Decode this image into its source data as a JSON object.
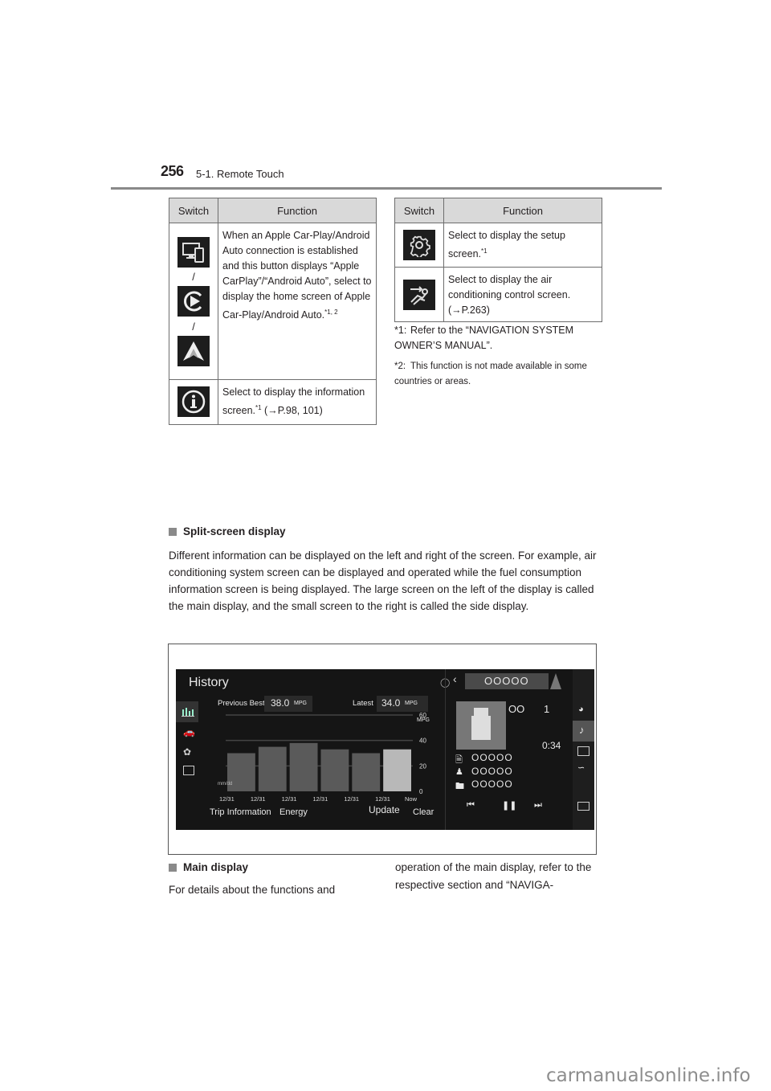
{
  "header": {
    "page_number": "256",
    "section": "5-1. Remote Touch"
  },
  "table_left": {
    "columns": [
      "Switch",
      "Function"
    ],
    "rows": [
      {
        "icons": [
          "apple-carplay-android-auto-icon",
          "carplay-play-icon",
          "android-auto-icon"
        ],
        "separator": "/",
        "function": "When an Apple Car-Play/Android Auto connection is established and this button displays “Apple CarPlay”/“Android Auto”, select to display the home screen of Apple Car-Play/Android Auto.",
        "footnote_ref": "*1, 2"
      },
      {
        "icons": [
          "info-icon"
        ],
        "function": "Select to display the information screen.",
        "footnote_ref": "*1",
        "page_ref": "(→P.98, 101)"
      }
    ]
  },
  "table_right": {
    "columns": [
      "Switch",
      "Function"
    ],
    "rows": [
      {
        "icons": [
          "settings-gear-icon"
        ],
        "function": "Select to display the setup screen.",
        "footnote_ref": "*1"
      },
      {
        "icons": [
          "air-conditioning-seat-icon"
        ],
        "function": "Select to display the air conditioning control screen.",
        "page_ref": "(→P.263)"
      }
    ]
  },
  "footnotes": [
    {
      "label": "*1:",
      "text": "Refer to the “NAVIGATION SYSTEM OWNER’S MANUAL”."
    },
    {
      "label": "*2:",
      "text": "This function is not made available in some countries or areas."
    }
  ],
  "split_screen": {
    "heading": "Split-screen display",
    "paragraph": "Different information can be displayed on the left and right of the screen. For example, air conditioning system screen can be displayed and operated while the fuel consumption information screen is being displayed. The large screen on the left of the display is called the main display, and the small screen to the right is called the side display."
  },
  "screen": {
    "main": {
      "title": "History",
      "previous_best_label": "Previous Best",
      "previous_best_value": "38.0",
      "latest_label": "Latest",
      "latest_value": "34.0",
      "unit": "MPG",
      "date_format_label": "mm/dd",
      "buttons": [
        "Trip Information",
        "Energy",
        "Update",
        "Clear"
      ],
      "sidebar_icons": [
        "bar-chart-icon",
        "cars-icon",
        "eco-leaf-icon",
        "list-icon"
      ]
    },
    "side": {
      "source_title": "OOOOO",
      "track_label": "OO",
      "track_number": "1",
      "time": "0:34",
      "song": "OOOOO",
      "artist": "OOOOO",
      "album": "OOOOO",
      "right_icons": [
        "navigation-icon",
        "music-note-icon",
        "fuel-chart-icon",
        "climate-icon",
        "video-icon"
      ],
      "controls": [
        "previous-track-icon",
        "pause-icon",
        "next-track-icon"
      ]
    }
  },
  "chart_data": {
    "type": "bar",
    "title": "History",
    "categories": [
      "12/31",
      "12/31",
      "12/31",
      "12/31",
      "12/31",
      "12/31"
    ],
    "x_end_label": "Now",
    "values": [
      30,
      35,
      38,
      33,
      30,
      33
    ],
    "highlighted_index": 5,
    "ylabel": "MPG",
    "xlabel": "mm/dd",
    "yticks": [
      0,
      20,
      40,
      60
    ],
    "ylim": [
      0,
      60
    ],
    "grid": true
  },
  "main_display": {
    "heading": "Main display",
    "paragraph_left": "For details about the functions and",
    "paragraph_right": "operation of the main display, refer to the respective section and “NAVIGA-"
  },
  "watermark": "carmanualsonline.info"
}
